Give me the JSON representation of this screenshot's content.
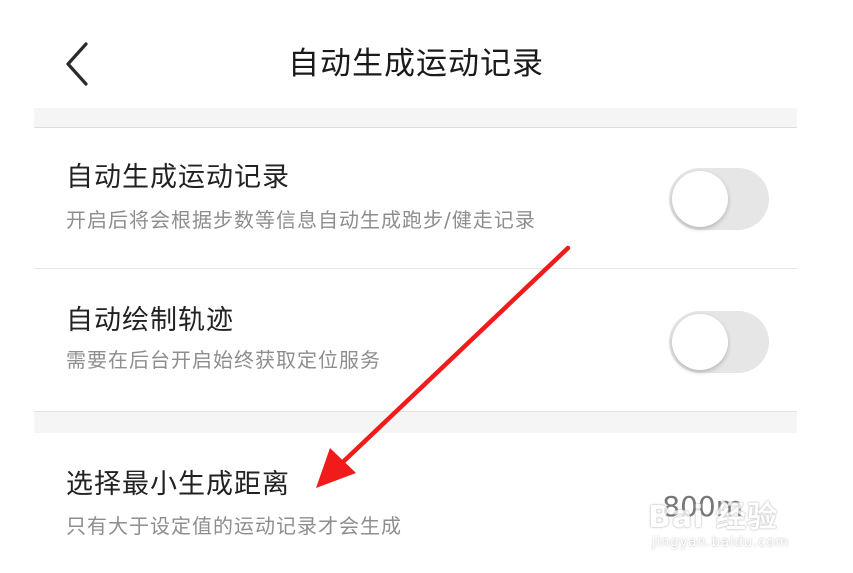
{
  "header": {
    "title": "自动生成运动记录",
    "back_icon": "chevron-left-icon"
  },
  "settings": [
    {
      "title": "自动生成运动记录",
      "subtitle": "开启后将会根据步数等信息自动生成跑步/健走记录",
      "control": "toggle",
      "enabled": false
    },
    {
      "title": "自动绘制轨迹",
      "subtitle": "需要在后台开启始终获取定位服务",
      "control": "toggle",
      "enabled": false
    },
    {
      "title": "选择最小生成距离",
      "subtitle": "只有大于设定值的运动记录才会生成",
      "control": "value",
      "value": "800m"
    }
  ],
  "annotation": {
    "color": "#f21b1b"
  },
  "watermark": {
    "main": "Bai 经验",
    "url": "jingyan.baidu.com"
  },
  "colors": {
    "toggle_off": "#e6e6e6",
    "section_gap": "#f5f5f5"
  }
}
